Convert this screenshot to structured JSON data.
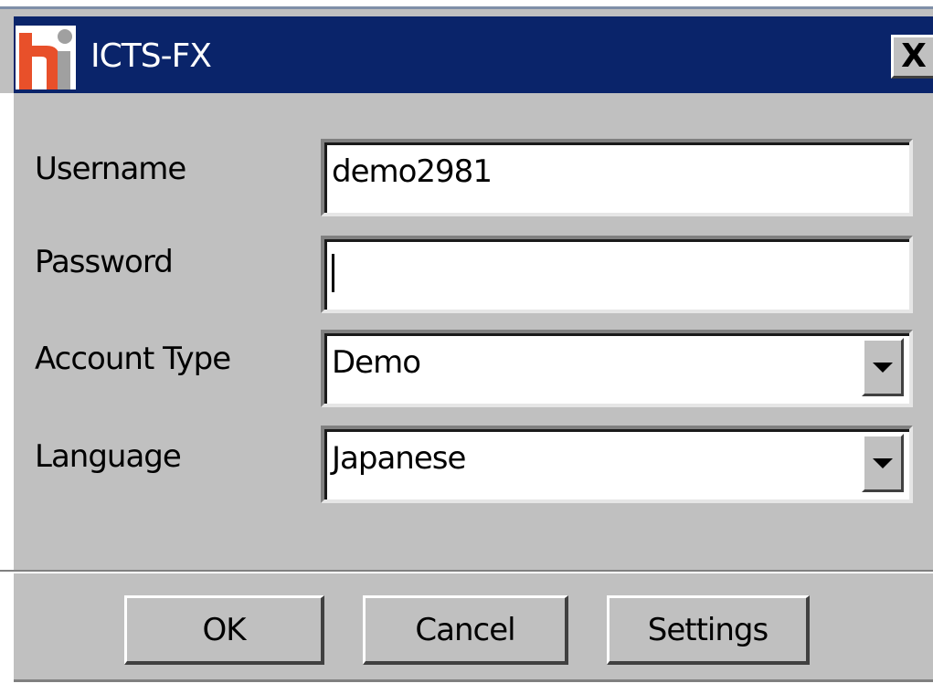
{
  "window": {
    "title": "ICTS-FX",
    "close_label": "X",
    "logo_icon": "hi-logo-icon",
    "colors": {
      "titlebar": "#0a246a",
      "face": "#c0c0c0",
      "logo_orange": "#e8502a",
      "logo_gray": "#a0a0a0"
    }
  },
  "form": {
    "username": {
      "label": "Username",
      "value": "demo2981"
    },
    "password": {
      "label": "Password",
      "value": ""
    },
    "account_type": {
      "label": "Account Type",
      "selected": "Demo"
    },
    "language": {
      "label": "Language",
      "selected": "Japanese"
    }
  },
  "buttons": {
    "ok": "OK",
    "cancel": "Cancel",
    "settings": "Settings"
  }
}
